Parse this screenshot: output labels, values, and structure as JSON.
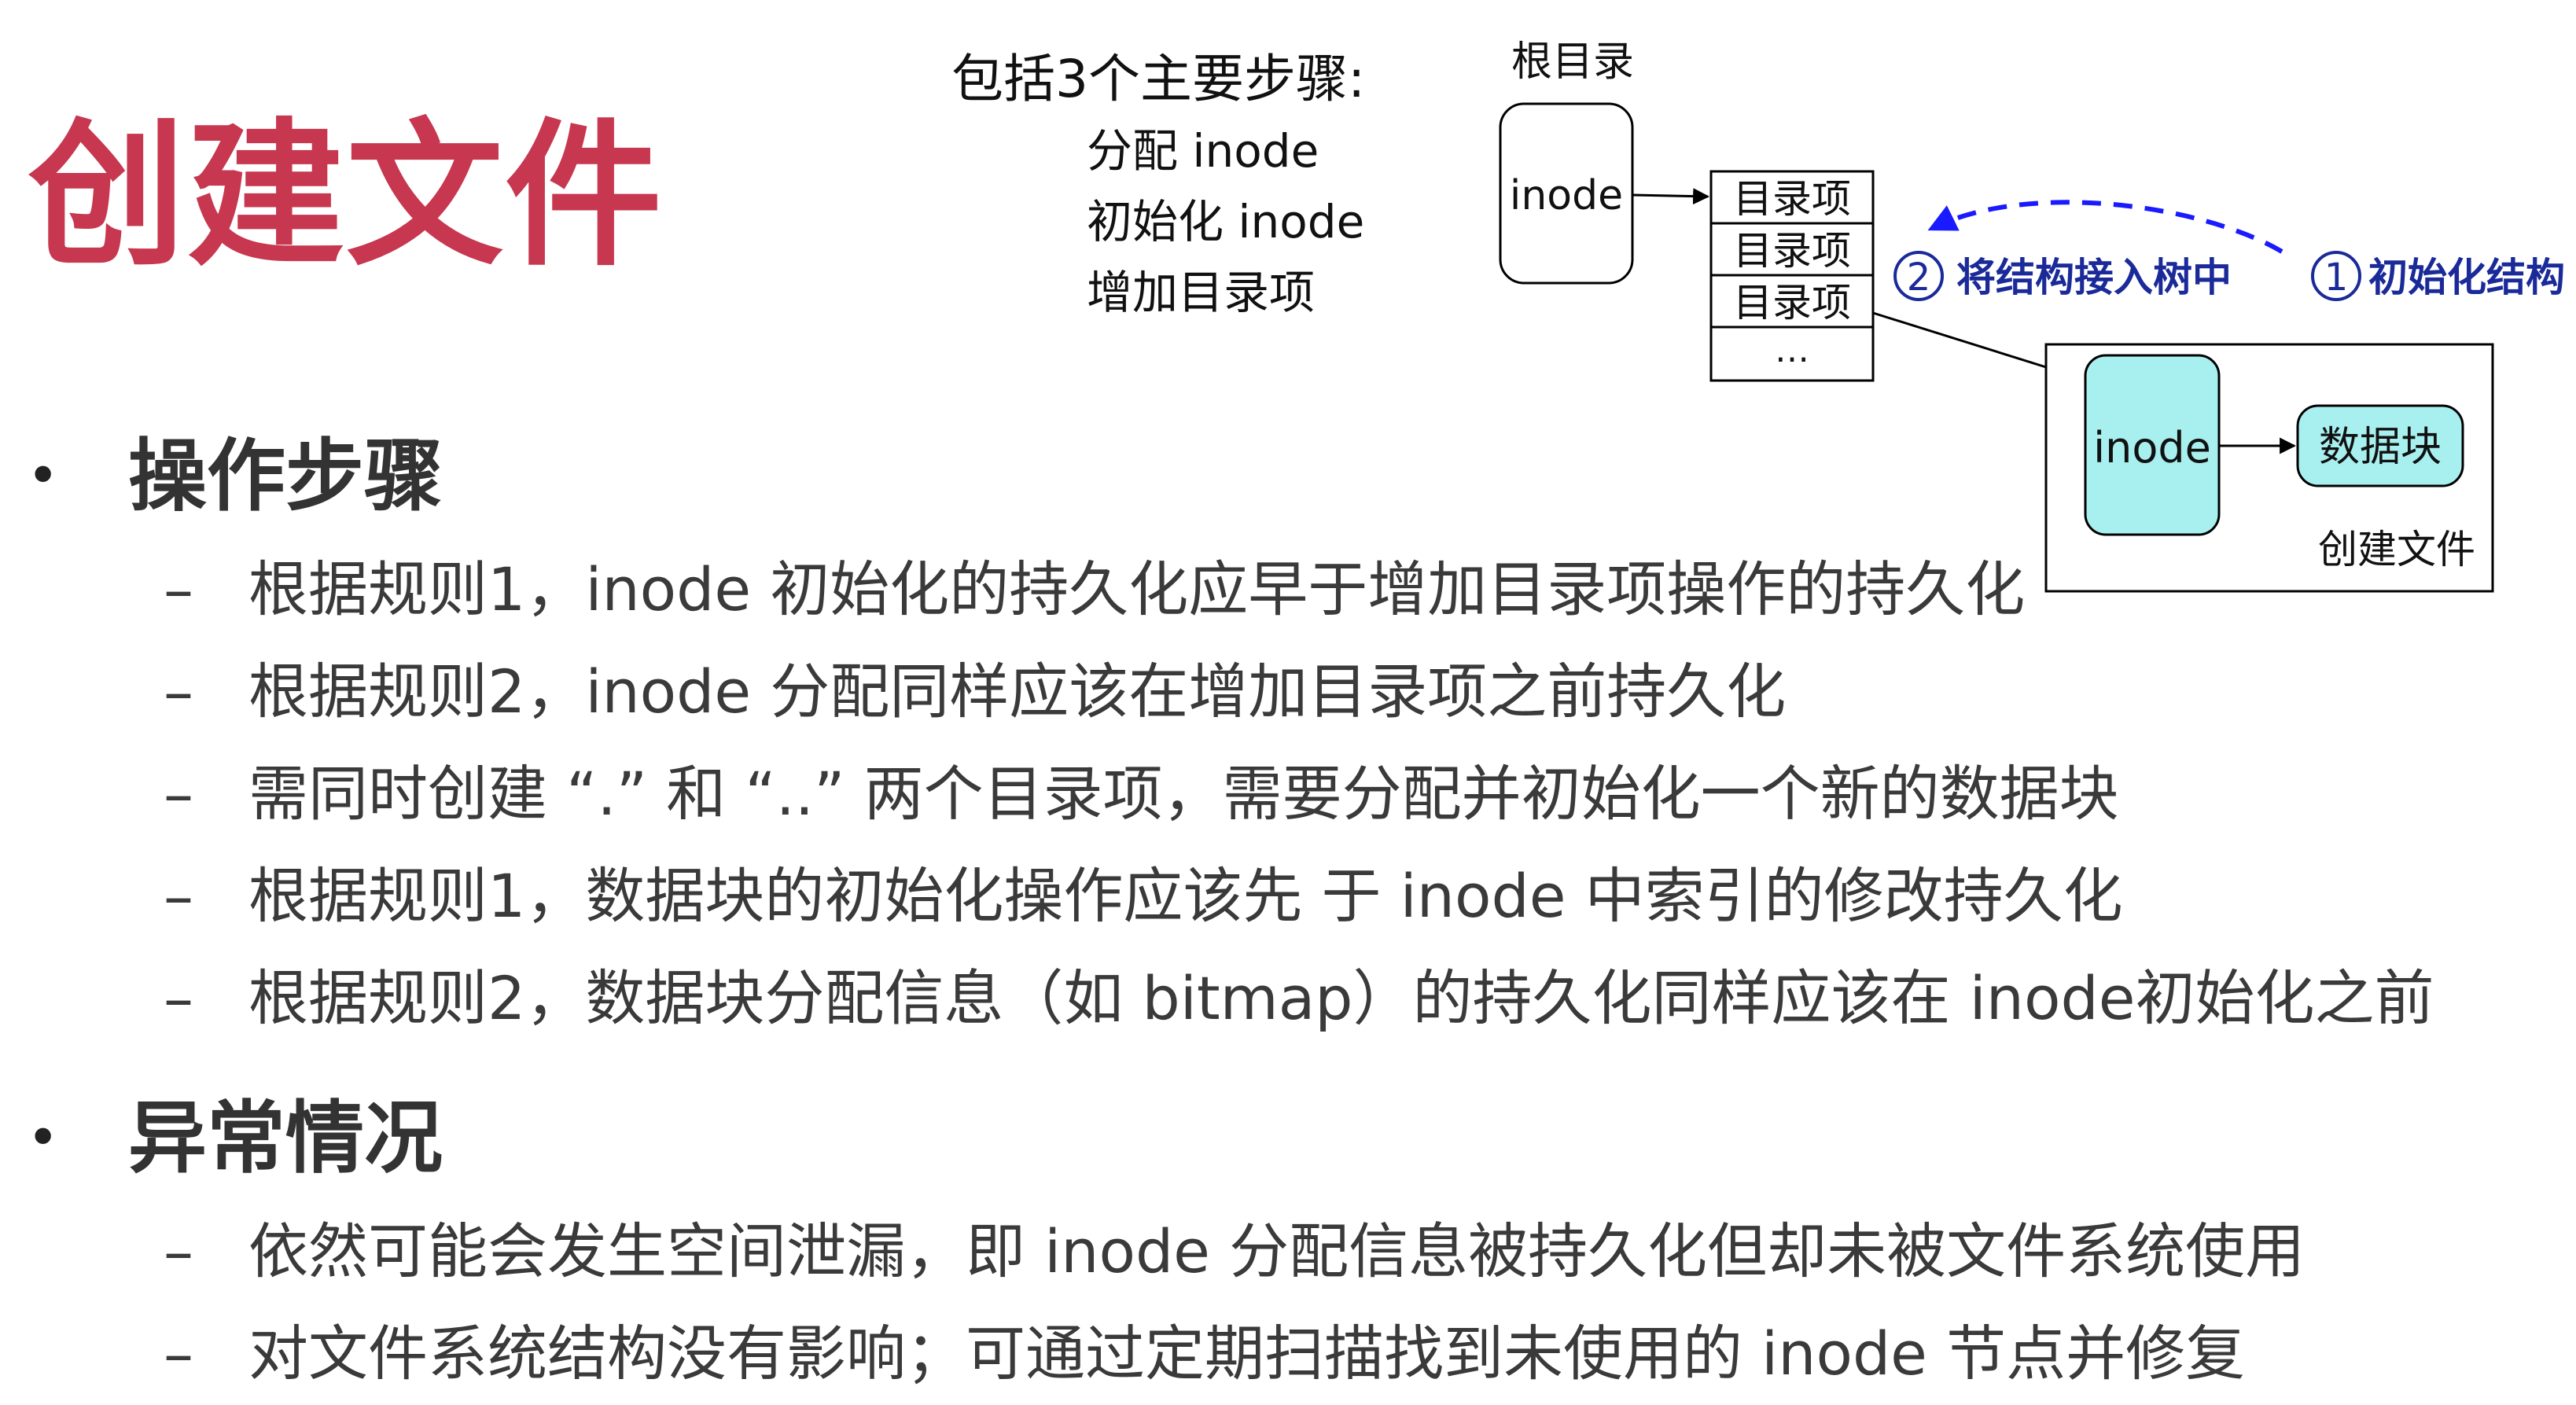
{
  "title": "创建文件",
  "steps_intro": {
    "heading": "包括3个主要步骤:",
    "items": [
      "分配 inode",
      "初始化 inode",
      "增加目录项"
    ]
  },
  "diagram": {
    "root_label": "根目录",
    "root_inode": "inode",
    "dir_entries": [
      "目录项",
      "目录项",
      "目录项",
      "…"
    ],
    "step2_num": "2",
    "step2_label": "将结构接入树中",
    "step1_num": "1",
    "step1_label": "初始化结构",
    "new_inode": "inode",
    "data_block": "数据块",
    "create_file_label": "创建文件",
    "colors": {
      "inode_fill": "#a8f0f0",
      "annotation": "#1a1aff",
      "annotation_text": "#1a2a99"
    }
  },
  "sections": [
    {
      "bullet": "•",
      "heading": "操作步骤",
      "items": [
        "根据规则1，inode 初始化的持久化应早于增加目录项操作的持久化",
        "根据规则2，inode 分配同样应该在增加目录项之前持久化",
        "需同时创建 “.” 和 “..” 两个目录项，需要分配并初始化一个新的数据块",
        "根据规则1，数据块的初始化操作应该先 于 inode 中索引的修改持久化",
        "根据规则2，数据块分配信息（如 bitmap）的持久化同样应该在 inode初始化之前"
      ]
    },
    {
      "bullet": "•",
      "heading": "异常情况",
      "items": [
        "依然可能会发生空间泄漏，即 inode 分配信息被持久化但却未被文件系统使用",
        "对文件系统结构没有影响；可通过定期扫描找到未使用的 inode 节点并修复"
      ]
    }
  ],
  "list_dash": "–",
  "colors": {
    "title": "#c7374f",
    "heading": "#333333",
    "body_text": "#3a3a3a"
  }
}
